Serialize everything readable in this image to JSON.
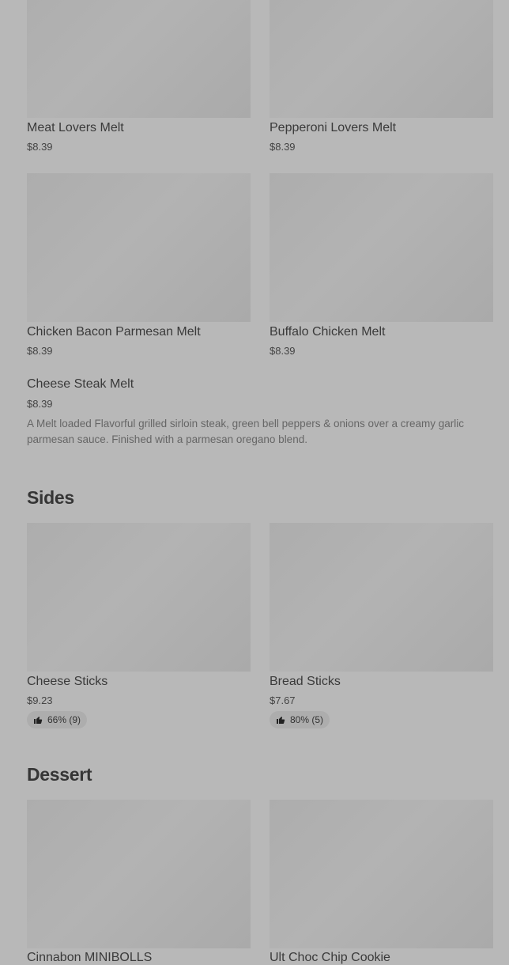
{
  "items": [
    {
      "name": "Meat Lovers Melt",
      "price": "$8.39"
    },
    {
      "name": "Pepperoni Lovers Melt",
      "price": "$8.39"
    },
    {
      "name": "Chicken Bacon Parmesan Melt",
      "price": "$8.39"
    },
    {
      "name": "Buffalo Chicken Melt",
      "price": "$8.39"
    },
    {
      "name": "Cheese Steak Melt",
      "price": "$8.39",
      "description": "A Melt loaded Flavorful grilled sirloin steak, green bell peppers & onions over a creamy garlic parmesan sauce. Finished with a parmesan oregano blend."
    }
  ],
  "sides": {
    "title": "Sides",
    "items": [
      {
        "name": "Cheese Sticks",
        "price": "$9.23",
        "rating": "66% (9)"
      },
      {
        "name": "Bread Sticks",
        "price": "$7.67",
        "rating": "80% (5)"
      }
    ]
  },
  "dessert": {
    "title": "Dessert",
    "items": [
      {
        "name": "Cinnabon MINIBOLLS"
      },
      {
        "name": "Ult Choc Chip Cookie"
      }
    ]
  },
  "icons": {
    "rating": "thumbs-up-icon"
  }
}
